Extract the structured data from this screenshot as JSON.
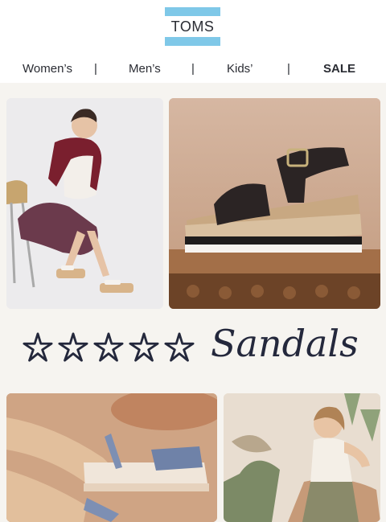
{
  "brand": {
    "logo_text": "TOMS",
    "color_brand": "#7fc8e8"
  },
  "nav": {
    "women": "Women’s",
    "men": "Men’s",
    "kids": "Kids’",
    "sale": "SALE",
    "separator": "|"
  },
  "rating": {
    "stars": 5,
    "icon": "star-icon"
  },
  "headline": "Sandals"
}
